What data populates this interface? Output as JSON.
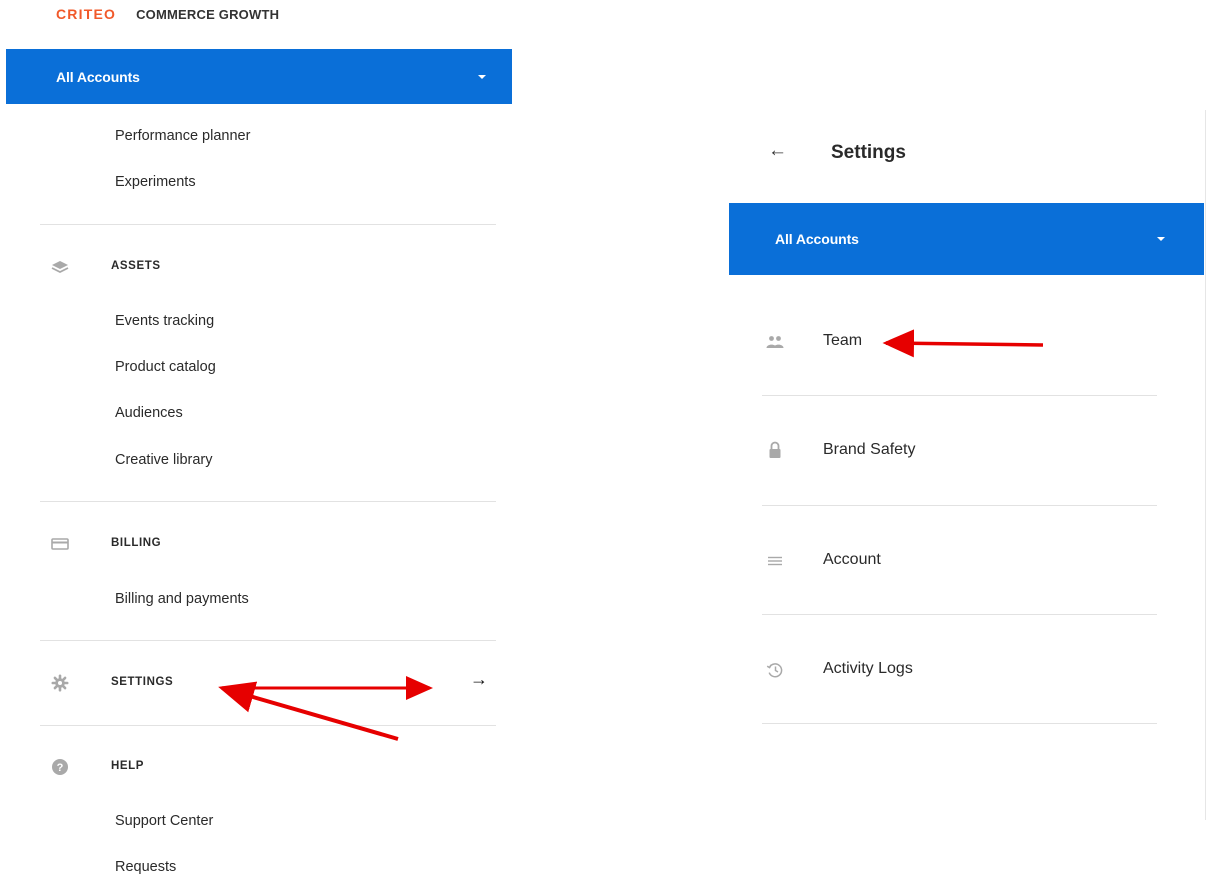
{
  "brand": {
    "logo": "CRITEO",
    "product": "COMMERCE GROWTH"
  },
  "left_panel": {
    "account_selector": {
      "label": "All Accounts"
    },
    "top_items": [
      "Performance planner",
      "Experiments"
    ],
    "sections": {
      "assets": {
        "label": "ASSETS",
        "icon": "layers-icon",
        "items": [
          "Events tracking",
          "Product catalog",
          "Audiences",
          "Creative library"
        ]
      },
      "billing": {
        "label": "BILLING",
        "icon": "credit-card-icon",
        "items": [
          "Billing and payments"
        ]
      },
      "settings": {
        "label": "SETTINGS",
        "icon": "gear-icon",
        "trailing_icon": "arrow-right-icon"
      },
      "help": {
        "label": "HELP",
        "icon": "help-circle-icon",
        "items": [
          "Support Center",
          "Requests"
        ]
      }
    }
  },
  "right_panel": {
    "title": "Settings",
    "back_icon": "arrow-left-icon",
    "account_selector": {
      "label": "All Accounts"
    },
    "items": [
      {
        "label": "Team",
        "icon": "people-icon"
      },
      {
        "label": "Brand Safety",
        "icon": "lock-icon"
      },
      {
        "label": "Account",
        "icon": "list-icon"
      },
      {
        "label": "Activity Logs",
        "icon": "history-icon"
      }
    ]
  },
  "colors": {
    "brand_orange": "#f1592a",
    "selector_blue": "#0a6fd8",
    "annotation_red": "#e60000",
    "icon_grey": "#a9a9a9"
  }
}
